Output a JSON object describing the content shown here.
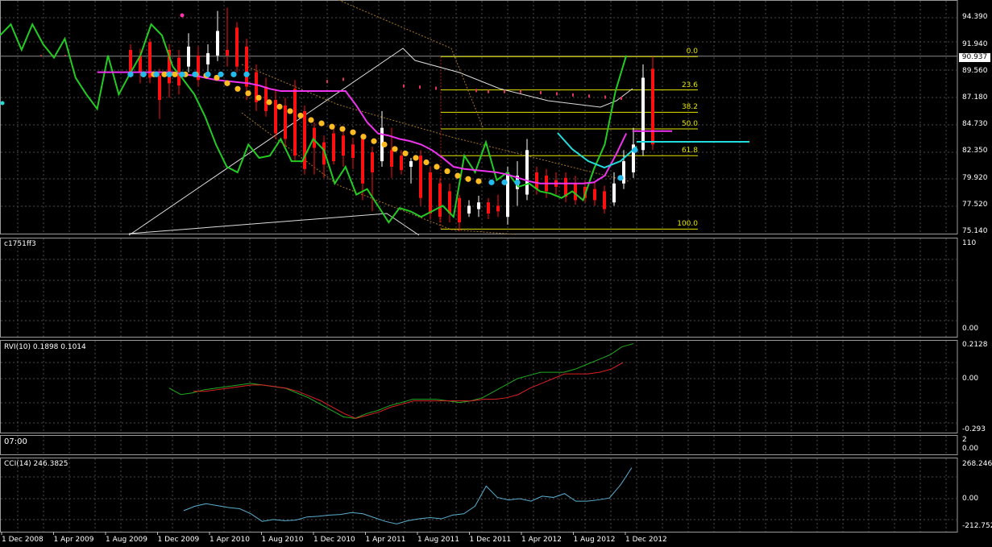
{
  "colors": {
    "background": "#000000",
    "grid": "#4a4a4a",
    "bull_candle": "#ffffff",
    "bear_candle": "#ff1010",
    "zigzag": "#22cc22",
    "ma_magenta": "#ee33ee",
    "dots_orange": "#ffbb22",
    "dots_cyan": "#22bbee",
    "fib": "#e6e600",
    "rvi_main": "#22aa22",
    "rvi_signal": "#dd2222",
    "cci": "#5aaecf"
  },
  "main_panel": {
    "current_price": "90.937",
    "price_ticks": [
      "94.390",
      "91.940",
      "89.560",
      "87.180",
      "84.730",
      "82.350",
      "79.920",
      "77.520",
      "75.140"
    ],
    "fib_levels": [
      {
        "label": "0.0",
        "price": 90.9
      },
      {
        "label": "23.6",
        "price": 87.9
      },
      {
        "label": "38.2",
        "price": 85.9
      },
      {
        "label": "50.0",
        "price": 84.4
      },
      {
        "label": "61.8",
        "price": 82.0
      },
      {
        "label": "100.0",
        "price": 75.4
      }
    ]
  },
  "panel_custom": {
    "title": "c1751ff3",
    "ticks": [
      "110",
      "0.00"
    ]
  },
  "panel_rvi": {
    "title": "RVI(10) 0.1898 0.1014",
    "ticks": [
      "0.2128",
      "0.00",
      "-0.293"
    ]
  },
  "panel_time": {
    "title": "07:00",
    "ticks": [
      "2",
      "0.00"
    ]
  },
  "panel_cci": {
    "title": "CCI(14) 246.3825",
    "ticks": [
      "268.246",
      "0.00",
      "-212.752"
    ]
  },
  "date_axis": [
    "1 Dec 2008",
    "1 Apr 2009",
    "1 Aug 2009",
    "1 Dec 2009",
    "1 Apr 2010",
    "1 Aug 2010",
    "1 Dec 2010",
    "1 Apr 2011",
    "1 Aug 2011",
    "1 Dec 2011",
    "1 Apr 2012",
    "1 Aug 2012",
    "1 Dec 2012"
  ],
  "chart_data": {
    "type": "line",
    "ylim": [
      75.14,
      95.5
    ],
    "candles": [
      {
        "o": 91.5,
        "h": 92.0,
        "l": 89.0,
        "c": 89.4
      },
      {
        "o": 91.0,
        "h": 91.6,
        "l": 88.5,
        "c": 89.5
      },
      {
        "o": 92.2,
        "h": 92.5,
        "l": 88.5,
        "c": 89.0
      },
      {
        "o": 89.2,
        "h": 89.8,
        "l": 85.3,
        "c": 87.0
      },
      {
        "o": 91.5,
        "h": 92.0,
        "l": 87.2,
        "c": 88.5
      },
      {
        "o": 90.8,
        "h": 91.5,
        "l": 87.5,
        "c": 88.3
      },
      {
        "o": 90.0,
        "h": 93.0,
        "l": 89.5,
        "c": 91.8
      },
      {
        "o": 91.0,
        "h": 91.8,
        "l": 88.2,
        "c": 88.8
      },
      {
        "o": 90.2,
        "h": 92.0,
        "l": 89.2,
        "c": 91.2
      },
      {
        "o": 91.0,
        "h": 95.0,
        "l": 90.5,
        "c": 93.2
      },
      {
        "o": 91.5,
        "h": 95.3,
        "l": 90.0,
        "c": 91.0
      },
      {
        "o": 93.5,
        "h": 94.0,
        "l": 89.5,
        "c": 90.0
      },
      {
        "o": 91.8,
        "h": 92.5,
        "l": 87.0,
        "c": 88.2
      },
      {
        "o": 89.5,
        "h": 90.2,
        "l": 86.0,
        "c": 86.8
      },
      {
        "o": 88.2,
        "h": 89.0,
        "l": 85.5,
        "c": 86.0
      },
      {
        "o": 87.0,
        "h": 88.0,
        "l": 83.5,
        "c": 84.0
      },
      {
        "o": 86.5,
        "h": 87.2,
        "l": 82.8,
        "c": 83.5
      },
      {
        "o": 88.0,
        "h": 88.8,
        "l": 81.5,
        "c": 82.0
      },
      {
        "o": 86.0,
        "h": 86.5,
        "l": 80.3,
        "c": 80.8
      },
      {
        "o": 84.5,
        "h": 85.0,
        "l": 80.3,
        "c": 82.7
      },
      {
        "o": 83.2,
        "h": 83.8,
        "l": 80.0,
        "c": 81.2
      },
      {
        "o": 84.0,
        "h": 84.5,
        "l": 81.2,
        "c": 81.5
      },
      {
        "o": 83.8,
        "h": 84.2,
        "l": 81.0,
        "c": 82.0
      },
      {
        "o": 83.0,
        "h": 83.6,
        "l": 80.8,
        "c": 81.8
      },
      {
        "o": 83.5,
        "h": 84.0,
        "l": 78.0,
        "c": 79.5
      },
      {
        "o": 82.3,
        "h": 82.8,
        "l": 77.0,
        "c": 80.5
      },
      {
        "o": 81.5,
        "h": 86.0,
        "l": 81.0,
        "c": 84.5
      },
      {
        "o": 82.5,
        "h": 84.5,
        "l": 80.0,
        "c": 81.0
      },
      {
        "o": 82.0,
        "h": 82.5,
        "l": 80.3,
        "c": 80.7
      },
      {
        "o": 81.0,
        "h": 81.8,
        "l": 79.5,
        "c": 81.5
      },
      {
        "o": 82.0,
        "h": 82.5,
        "l": 77.5,
        "c": 78.2
      },
      {
        "o": 80.5,
        "h": 81.0,
        "l": 76.3,
        "c": 76.8
      },
      {
        "o": 79.5,
        "h": 80.0,
        "l": 76.0,
        "c": 76.5
      },
      {
        "o": 78.8,
        "h": 79.5,
        "l": 76.0,
        "c": 76.8
      },
      {
        "o": 78.2,
        "h": 78.5,
        "l": 75.2,
        "c": 76.0
      },
      {
        "o": 76.8,
        "h": 78.0,
        "l": 76.5,
        "c": 77.5
      },
      {
        "o": 77.2,
        "h": 78.4,
        "l": 76.5,
        "c": 77.8
      },
      {
        "o": 77.8,
        "h": 78.2,
        "l": 76.3,
        "c": 76.8
      },
      {
        "o": 77.5,
        "h": 78.5,
        "l": 76.5,
        "c": 77.0
      },
      {
        "o": 76.5,
        "h": 81.0,
        "l": 75.8,
        "c": 80.5
      },
      {
        "o": 79.0,
        "h": 81.5,
        "l": 77.5,
        "c": 80.2
      },
      {
        "o": 78.5,
        "h": 83.5,
        "l": 78.0,
        "c": 82.5
      },
      {
        "o": 80.5,
        "h": 81.0,
        "l": 78.5,
        "c": 79.0
      },
      {
        "o": 80.2,
        "h": 80.8,
        "l": 78.2,
        "c": 78.8
      },
      {
        "o": 79.8,
        "h": 80.5,
        "l": 78.5,
        "c": 79.2
      },
      {
        "o": 80.0,
        "h": 80.5,
        "l": 77.8,
        "c": 78.3
      },
      {
        "o": 79.5,
        "h": 80.2,
        "l": 77.6,
        "c": 78.0
      },
      {
        "o": 79.2,
        "h": 79.8,
        "l": 77.8,
        "c": 78.2
      },
      {
        "o": 79.0,
        "h": 79.6,
        "l": 77.5,
        "c": 78.0
      },
      {
        "o": 78.8,
        "h": 79.3,
        "l": 76.8,
        "c": 77.2
      },
      {
        "o": 77.8,
        "h": 80.5,
        "l": 77.5,
        "c": 79.5
      },
      {
        "o": 79.5,
        "h": 82.5,
        "l": 79.0,
        "c": 81.5
      },
      {
        "o": 80.5,
        "h": 84.5,
        "l": 80.0,
        "c": 83.0
      },
      {
        "o": 82.5,
        "h": 90.2,
        "l": 82.0,
        "c": 89.0
      },
      {
        "o": 89.8,
        "h": 90.9,
        "l": 82.5,
        "c": 83.0
      }
    ],
    "zigzag": [
      92.8,
      93.8,
      91.5,
      93.8,
      92.0,
      90.8,
      92.5,
      89.0,
      87.5,
      86.2,
      91.0,
      87.5,
      89.3,
      91.0,
      93.8,
      92.8,
      90.0,
      88.8,
      87.5,
      85.5,
      83.0,
      81.0,
      80.5,
      83.0,
      81.8,
      82.0,
      83.5,
      81.5,
      81.5,
      83.5,
      82.5,
      79.5,
      81.0,
      78.5,
      79.0,
      77.5,
      76.0,
      77.3,
      77.0,
      76.5,
      77.0,
      77.5,
      76.5,
      82.0,
      80.5,
      83.2,
      79.8,
      80.5,
      79.2,
      79.5,
      78.8,
      78.6,
      78.2,
      78.8,
      78.0,
      80.8,
      83.0,
      87.8,
      91.0
    ],
    "magenta_ma": [
      null,
      null,
      null,
      null,
      null,
      null,
      null,
      null,
      null,
      89.5,
      89.5,
      89.5,
      89.5,
      89.5,
      89.5,
      89.5,
      89.5,
      89.3,
      89.2,
      89.0,
      88.8,
      88.7,
      88.6,
      88.5,
      88.3,
      88.0,
      87.8,
      87.8,
      87.8,
      87.8,
      87.8,
      87.8,
      87.8,
      86.5,
      85.0,
      84.0,
      83.8,
      83.5,
      83.3,
      83.0,
      82.5,
      81.8,
      81.0,
      80.8,
      80.7,
      80.6,
      80.5,
      80.3,
      80.0,
      79.7,
      79.5,
      79.5,
      79.5,
      79.5,
      79.5,
      79.6,
      80.2,
      82.0,
      84.0
    ],
    "orange_dots": [
      89.3,
      89.3,
      89.3,
      89.3,
      89.3,
      89.3,
      89.2,
      89.0,
      88.5,
      88.0,
      87.6,
      87.2,
      86.8,
      86.4,
      86.0,
      85.6,
      85.2,
      84.9,
      84.6,
      84.4,
      84.1,
      83.7,
      83.3,
      83.0,
      82.6,
      82.2,
      81.8,
      81.4,
      81.0,
      80.6,
      80.2,
      79.9,
      79.7
    ],
    "cyan_dots": [
      89.3,
      89.3,
      89.3,
      89.3,
      89.3,
      89.3,
      89.3,
      89.3,
      89.3,
      89.3,
      79.6,
      79.6,
      79.6,
      80.0,
      82.5
    ],
    "custom_indicator": [],
    "rvi_main": [
      -0.06,
      -0.1,
      -0.09,
      -0.07,
      -0.06,
      -0.05,
      -0.04,
      -0.03,
      -0.04,
      -0.05,
      -0.06,
      -0.09,
      -0.12,
      -0.16,
      -0.2,
      -0.24,
      -0.25,
      -0.22,
      -0.2,
      -0.17,
      -0.15,
      -0.13,
      -0.13,
      -0.13,
      -0.14,
      -0.15,
      -0.14,
      -0.12,
      -0.08,
      -0.04,
      0.0,
      0.02,
      0.04,
      0.04,
      0.04,
      0.06,
      0.09,
      0.12,
      0.15,
      0.2,
      0.22
    ],
    "rvi_signal": [
      -0.08,
      -0.08,
      -0.07,
      -0.06,
      -0.05,
      -0.04,
      -0.04,
      -0.05,
      -0.06,
      -0.08,
      -0.11,
      -0.14,
      -0.18,
      -0.22,
      -0.25,
      -0.23,
      -0.21,
      -0.18,
      -0.16,
      -0.14,
      -0.14,
      -0.14,
      -0.14,
      -0.14,
      -0.14,
      -0.13,
      -0.13,
      -0.12,
      -0.1,
      -0.06,
      -0.03,
      0.0,
      0.03,
      0.03,
      0.03,
      0.04,
      0.06,
      0.1
    ],
    "cci": [
      -95,
      -60,
      -40,
      -55,
      -70,
      -80,
      -120,
      -180,
      -165,
      -175,
      -170,
      -145,
      -140,
      -130,
      -125,
      -110,
      -120,
      -150,
      -180,
      -200,
      -175,
      -160,
      -150,
      -160,
      -130,
      -120,
      -60,
      100,
      10,
      -10,
      0,
      -20,
      20,
      10,
      40,
      -20,
      -20,
      -10,
      5,
      110,
      246
    ]
  }
}
